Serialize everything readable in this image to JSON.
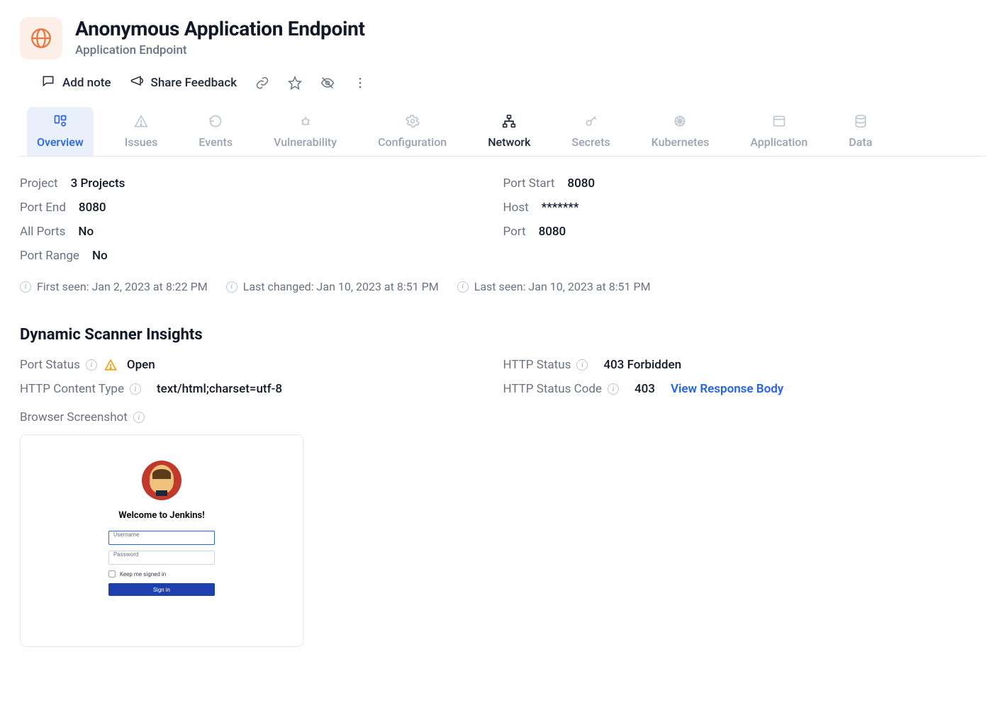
{
  "header": {
    "title": "Anonymous Application Endpoint",
    "subtitle": "Application Endpoint"
  },
  "actions": {
    "add_note": "Add note",
    "share_feedback": "Share Feedback"
  },
  "tabs": {
    "overview": "Overview",
    "issues": "Issues",
    "events": "Events",
    "vulnerability": "Vulnerability",
    "configuration": "Configuration",
    "network": "Network",
    "secrets": "Secrets",
    "kubernetes": "Kubernetes",
    "application": "Application",
    "data": "Data"
  },
  "details": {
    "left": {
      "project_label": "Project",
      "project_value": "3 Projects",
      "port_end_label": "Port End",
      "port_end_value": "8080",
      "all_ports_label": "All Ports",
      "all_ports_value": "No",
      "port_range_label": "Port Range",
      "port_range_value": "No"
    },
    "right": {
      "port_start_label": "Port Start",
      "port_start_value": "8080",
      "host_label": "Host",
      "host_value": "*******",
      "port_label": "Port",
      "port_value": "8080"
    }
  },
  "timestamps": {
    "first_seen": "First seen: Jan 2, 2023 at 8:22 PM",
    "last_changed": "Last changed: Jan 10, 2023 at 8:51 PM",
    "last_seen": "Last seen: Jan 10, 2023 at 8:51 PM"
  },
  "section_title": "Dynamic Scanner Insights",
  "insights": {
    "port_status_label": "Port Status",
    "port_status_value": "Open",
    "http_content_type_label": "HTTP Content Type",
    "http_content_type_value": "text/html;charset=utf-8",
    "browser_screenshot_label": "Browser Screenshot",
    "http_status_label": "HTTP Status",
    "http_status_value": "403 Forbidden",
    "http_status_code_label": "HTTP Status Code",
    "http_status_code_value": "403",
    "view_response_body": "View Response Body"
  },
  "screenshot": {
    "welcome": "Welcome to Jenkins!",
    "username_placeholder": "Username",
    "password_placeholder": "Password",
    "keep_signed_in": "Keep me signed in",
    "sign_in": "Sign in"
  }
}
